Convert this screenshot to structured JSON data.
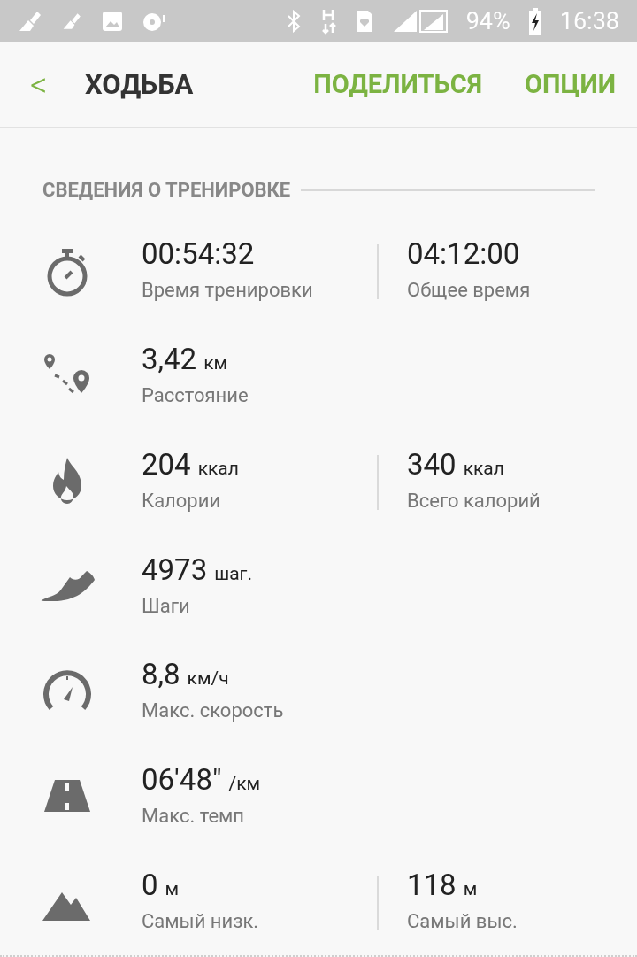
{
  "status_bar": {
    "battery": "94%",
    "time": "16:38"
  },
  "header": {
    "back": "<",
    "title": "ХОДЬБА",
    "actions": [
      "ПОДЕЛИТЬСЯ",
      "ОПЦИИ"
    ]
  },
  "section": {
    "title": "СВЕДЕНИЯ О ТРЕНИРОВКЕ"
  },
  "rows": [
    {
      "kind": "timer",
      "stats": [
        {
          "value": "00:54:32",
          "label": "Время тренировки"
        },
        {
          "value": "04:12:00",
          "label": "Общее время"
        }
      ]
    },
    {
      "kind": "distance",
      "stats": [
        {
          "value": "3,42",
          "unit": "км",
          "label": "Расстояние"
        }
      ]
    },
    {
      "kind": "calories",
      "stats": [
        {
          "value": "204",
          "unit": "ккал",
          "label": "Калории"
        },
        {
          "value": "340",
          "unit": "ккал",
          "label": "Всего калорий"
        }
      ]
    },
    {
      "kind": "steps",
      "stats": [
        {
          "value": "4973",
          "unit": "шаг.",
          "label": "Шаги"
        }
      ]
    },
    {
      "kind": "speed",
      "stats": [
        {
          "value": "8,8",
          "unit": "км/ч",
          "label": "Макс. скорость"
        }
      ]
    },
    {
      "kind": "pace",
      "stats": [
        {
          "value": "06'48\"",
          "unit": "/км",
          "label": "Макс. темп"
        }
      ]
    },
    {
      "kind": "altitude",
      "stats": [
        {
          "value": "0",
          "unit": "м",
          "label": "Самый низк."
        },
        {
          "value": "118",
          "unit": "м",
          "label": "Самый выс."
        }
      ]
    }
  ]
}
